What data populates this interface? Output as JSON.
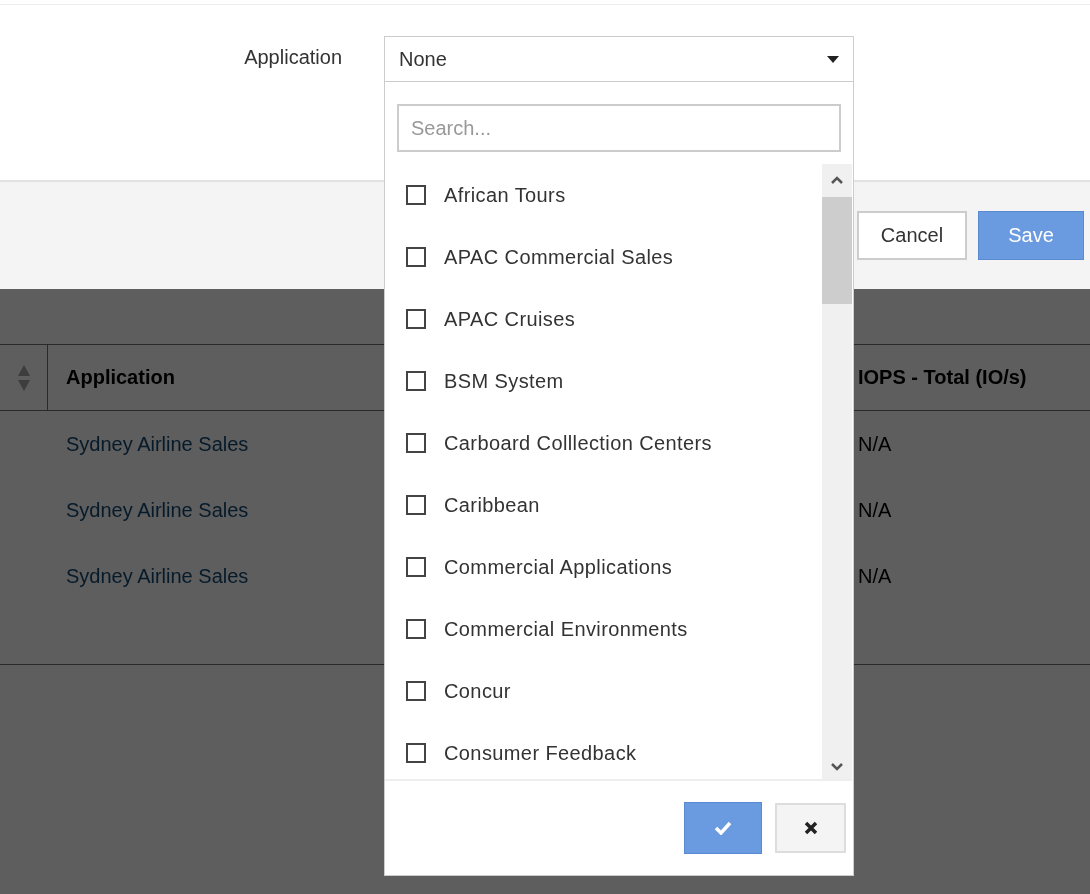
{
  "form": {
    "label": "Application",
    "select": {
      "value": "None"
    }
  },
  "actions": [
    {
      "label": "Cancel",
      "kind": "secondary"
    },
    {
      "label": "Save",
      "kind": "primary"
    }
  ],
  "table": {
    "columns": [
      "Application",
      "IOPS - Total (IO/s)"
    ],
    "rows": [
      [
        "Sydney Airline Sales",
        "N/A"
      ],
      [
        "Sydney Airline Sales",
        "N/A"
      ],
      [
        "Sydney Airline Sales",
        "N/A"
      ]
    ]
  },
  "dropdown": {
    "search": {
      "placeholder": "Search..."
    },
    "options": [
      {
        "label": "African Tours",
        "checked": false
      },
      {
        "label": "APAC Commercial Sales",
        "checked": false
      },
      {
        "label": "APAC Cruises",
        "checked": false
      },
      {
        "label": "BSM System",
        "checked": false
      },
      {
        "label": "Carboard Colllection Centers",
        "checked": false
      },
      {
        "label": "Caribbean",
        "checked": false
      },
      {
        "label": "Commercial Applications",
        "checked": false
      },
      {
        "label": "Commercial Environments",
        "checked": false
      },
      {
        "label": "Concur",
        "checked": false
      },
      {
        "label": "Consumer Feedback",
        "checked": false
      }
    ]
  }
}
